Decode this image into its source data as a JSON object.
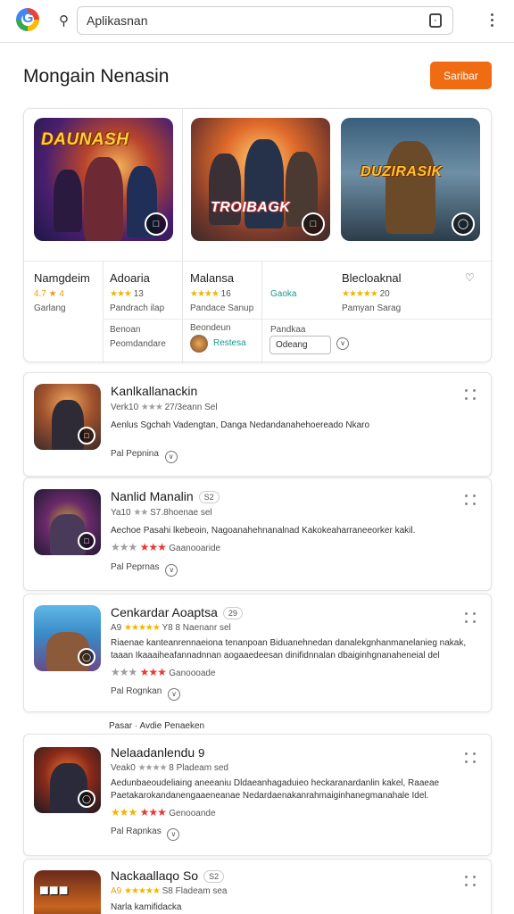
{
  "topbar": {
    "logo": "G",
    "search_placeholder": "Aplikasi",
    "search_value": "Aplikasnan"
  },
  "header": {
    "title": "Mongain Nenasin",
    "button": "Saribar"
  },
  "featured": {
    "images": [
      {
        "title": "DAUNASH"
      },
      {
        "title": "TROIBAGK"
      },
      {
        "title": "DUZIRASIK"
      }
    ],
    "col1": {
      "name": "Namgdeim",
      "rating": "4.7 ★ 4",
      "sub": "Garlang"
    },
    "col2": {
      "name": "Adoaria",
      "stars": "★★★",
      "rating": "13",
      "sub": "Pandrach ilap",
      "foot1": "Benoan",
      "foot2": "Peomdandare"
    },
    "col3": {
      "name": "Malansa",
      "stars": "★★★★",
      "rating": "16",
      "sub": "Pandace Sanup",
      "foot1": "Beondeun",
      "tag": "Restesa"
    },
    "col4": {
      "label": "Gaoka",
      "foot1": "Pandkaa"
    },
    "col5": {
      "name": "Blecloaknal",
      "stars": "★★★★★",
      "rating": "20",
      "sub": "Pamyan Sarag"
    },
    "dropdown": "Odeang"
  },
  "apps": [
    {
      "name": "Kanlkallanackin",
      "meta_prefix": "Verk10",
      "stars": "★★★",
      "meta": "27/3eann Sel",
      "desc": "Aenlus Sgchah Vadengtan, Danga Nedandanahehoereado Nkaro",
      "foot": "Pal Pepnina"
    },
    {
      "name": "Nanlid Manalin",
      "pill": "S2",
      "meta_prefix": "Ya10",
      "stars": "★★",
      "meta": "S7.8hoenae sel",
      "desc": "Aechoe Pasahi lkebeoin, Nagoanahehnanalnad Kakokeaharraneeorker kakil.",
      "ratingline_gray": "★★★",
      "ratingline_red": "★★★",
      "ratingline_text": "Gaanooaride",
      "foot": "Pal Peprnas"
    },
    {
      "name": "Cenkardar Aoaptsa",
      "pill": "29",
      "meta_prefix": "A9",
      "stars": "★★★★★",
      "meta": "Y8 8 Naenanr sel",
      "desc": "Riaenae kanteanrennaeiona tenanpoan Biduanehnedan danalekgnhanmanelanieg nakak, taaan Ikaaaiheafannadnnan aogaaedeesan dinifidnnalan dbaiginhgnanaheneial del",
      "ratingline_gray": "★★★",
      "ratingline_red": "★★★",
      "ratingline_text": "Ganoooade",
      "foot": "Pal Rognkan"
    },
    {
      "name": "Nelaadanlendu",
      "pill": "9",
      "meta_prefix": "Veak0",
      "stars": "★★★★",
      "meta": "8 Pladeam sed",
      "desc": "Aedunbaeoudeliaing aneeaniu Dldaeanhagaduieo heckaranardanlin kakel, Raaeae Paetakarokandanengaaeneanae Nedardaenakanrahmaiginhanegmanahale Idel.",
      "ratingline_gray": "★★★",
      "ratingline_red": "★★★",
      "ratingline_text": "Genooande",
      "foot": "Pal Rapnkas"
    },
    {
      "name": "Nackaallaqo So",
      "pill": "S2",
      "meta_prefix": "A9",
      "stars": "★★★★★",
      "meta": "S8 Fladeam sea",
      "desc": "Narla kamifidacka"
    }
  ],
  "section_label": "Pasar · Avdie Penaeken",
  "colors": {
    "accent": "#ef6c12",
    "star": "#f2b600",
    "star_red": "#e53935"
  }
}
